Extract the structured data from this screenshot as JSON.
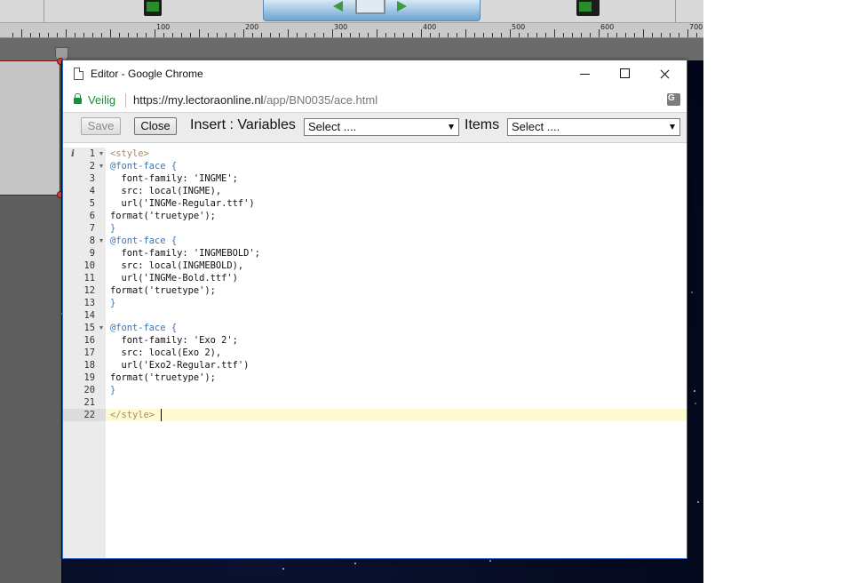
{
  "window": {
    "title": "Editor - Google Chrome",
    "secure_label": "Veilig",
    "url_host": "https://my.lectoraonline.nl",
    "url_path": "/app/BN0035/ace.html",
    "icons": [
      "page-icon",
      "lock-icon",
      "translate-icon",
      "minimize-icon",
      "maximize-icon",
      "close-icon"
    ]
  },
  "toolbar": {
    "save_label": "Save",
    "close_label": "Close",
    "insert_label": "Insert : Variables",
    "variables_select": "Select ....",
    "items_label": "Items",
    "items_select": "Select ...."
  },
  "editor": {
    "active_line": 22,
    "lines": [
      {
        "n": "1",
        "text": "<style>",
        "fold": true,
        "kind": "tag"
      },
      {
        "n": "2",
        "text": "@font-face {",
        "fold": true,
        "kind": "kw"
      },
      {
        "n": "3",
        "text": "  font-family: 'INGME';",
        "fold": false,
        "kind": "plain"
      },
      {
        "n": "4",
        "text": "  src: local(INGME),",
        "fold": false,
        "kind": "plain"
      },
      {
        "n": "5",
        "text": "  url('INGMe-Regular.ttf')",
        "fold": false,
        "kind": "plain"
      },
      {
        "n": "6",
        "text": "format('truetype');",
        "fold": false,
        "kind": "plain"
      },
      {
        "n": "7",
        "text": "}",
        "fold": false,
        "kind": "kw"
      },
      {
        "n": "8",
        "text": "@font-face {",
        "fold": true,
        "kind": "kw"
      },
      {
        "n": "9",
        "text": "  font-family: 'INGMEBOLD';",
        "fold": false,
        "kind": "plain"
      },
      {
        "n": "10",
        "text": "  src: local(INGMEBOLD),",
        "fold": false,
        "kind": "plain"
      },
      {
        "n": "11",
        "text": "  url('INGMe-Bold.ttf')",
        "fold": false,
        "kind": "plain"
      },
      {
        "n": "12",
        "text": "format('truetype');",
        "fold": false,
        "kind": "plain"
      },
      {
        "n": "13",
        "text": "}",
        "fold": false,
        "kind": "kw"
      },
      {
        "n": "14",
        "text": "",
        "fold": false,
        "kind": "plain"
      },
      {
        "n": "15",
        "text": "@font-face {",
        "fold": true,
        "kind": "kw"
      },
      {
        "n": "16",
        "text": "  font-family: 'Exo 2';",
        "fold": false,
        "kind": "plain"
      },
      {
        "n": "17",
        "text": "  src: local(Exo 2),",
        "fold": false,
        "kind": "plain"
      },
      {
        "n": "18",
        "text": "  url('Exo2-Regular.ttf')",
        "fold": false,
        "kind": "plain"
      },
      {
        "n": "19",
        "text": "format('truetype');",
        "fold": false,
        "kind": "plain"
      },
      {
        "n": "20",
        "text": "}",
        "fold": false,
        "kind": "kw"
      },
      {
        "n": "21",
        "text": "",
        "fold": false,
        "kind": "plain"
      },
      {
        "n": "22",
        "text": "</style>",
        "fold": false,
        "kind": "tag"
      }
    ]
  },
  "background_app": {
    "ruler_labels": [
      "100",
      "200",
      "300",
      "400",
      "500",
      "600",
      "700"
    ],
    "icons": [
      "phone-icon",
      "monitor-icon",
      "arrow-left-icon",
      "arrow-right-icon"
    ],
    "colors": {
      "chrome_border": "#2d6fc6",
      "secure_green": "#1e8a3c",
      "active_line": "#fffbd1"
    }
  }
}
